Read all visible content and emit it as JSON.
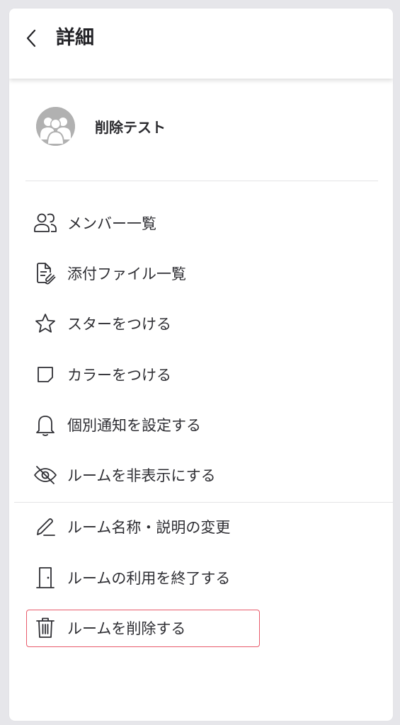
{
  "header": {
    "title": "詳細",
    "back_icon": "chevron-left-icon"
  },
  "room": {
    "name": "削除テスト",
    "avatar_icon": "group-avatar-icon"
  },
  "menu_group_1": [
    {
      "label": "メンバー一覧",
      "icon": "members-icon"
    },
    {
      "label": "添付ファイル一覧",
      "icon": "attachment-file-icon"
    },
    {
      "label": "スターをつける",
      "icon": "star-icon"
    },
    {
      "label": "カラーをつける",
      "icon": "note-color-icon"
    },
    {
      "label": "個別通知を設定する",
      "icon": "bell-icon"
    },
    {
      "label": "ルームを非表示にする",
      "icon": "eye-off-icon"
    }
  ],
  "menu_group_2": [
    {
      "label": "ルーム名称・説明の変更",
      "icon": "pencil-icon"
    },
    {
      "label": "ルームの利用を終了する",
      "icon": "door-icon"
    },
    {
      "label": "ルームを削除する",
      "icon": "trash-icon"
    }
  ],
  "colors": {
    "background": "#e6e6ea",
    "card": "#ffffff",
    "text": "#2e2e33",
    "highlight_border": "#e85a6a",
    "avatar": "#b1b1b1"
  }
}
